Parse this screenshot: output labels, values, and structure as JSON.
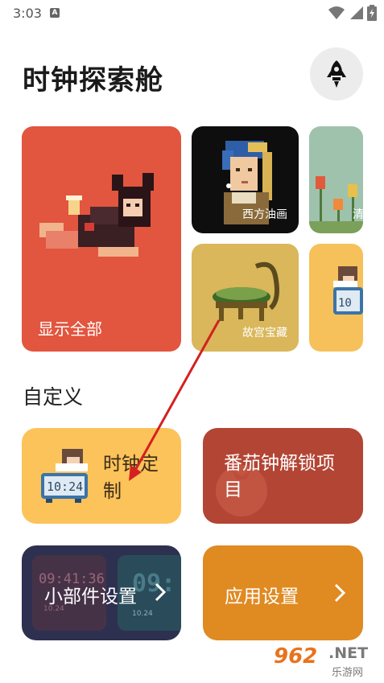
{
  "status_bar": {
    "time": "3:03",
    "notification_letter": "A"
  },
  "header": {
    "title": "时钟探索舱",
    "rocket_icon": "rocket-icon"
  },
  "gallery": {
    "show_all_label": "显示全部",
    "oil_painting_label": "西方油画",
    "palace_label": "故宫宝藏",
    "tulip_label": "清"
  },
  "custom": {
    "section_title": "自定义",
    "clock_custom_label": "时钟定制",
    "pomodoro_label": "番茄钟解锁项目",
    "widget_settings_label": "小部件设置",
    "widget_preview_time1": "09:41:36",
    "widget_preview_date1": "10.24",
    "widget_preview_time2": "09:",
    "widget_preview_date2": "10.24",
    "app_settings_label": "应用设置",
    "clock_preview_digits": "10:24"
  },
  "watermark": {
    "brand": "962",
    "domain": ".NET",
    "subtitle": "乐游网"
  },
  "colors": {
    "show_all_card": "#e2553f",
    "palace_card": "#d9b75a",
    "clock_tile": "#fbc35a",
    "pomodoro_tile": "#b34534",
    "widget_tile": "#2e3050",
    "app_tile": "#e08a22",
    "annotation_arrow": "#d42020"
  }
}
